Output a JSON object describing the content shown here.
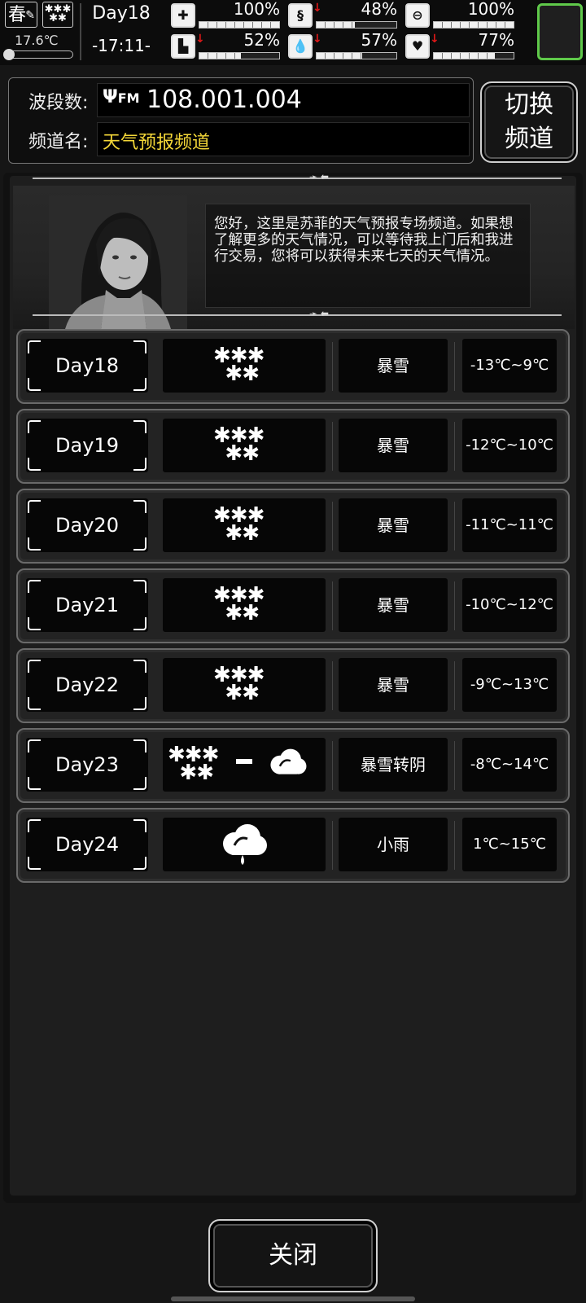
{
  "status": {
    "season": "春",
    "temperature": "17.6℃",
    "day": "Day18",
    "time": "-17:11-",
    "stats": [
      {
        "name": "health",
        "value": "100%",
        "fill": 1.0,
        "down": false,
        "icon": "medkit-icon"
      },
      {
        "name": "hunger",
        "value": "48%",
        "fill": 0.48,
        "down": true,
        "icon": "stomach-icon"
      },
      {
        "name": "medicine",
        "value": "100%",
        "fill": 1.0,
        "down": false,
        "icon": "pill-icon"
      },
      {
        "name": "stamina",
        "value": "52%",
        "fill": 0.52,
        "down": true,
        "icon": "boot-icon"
      },
      {
        "name": "thirst",
        "value": "57%",
        "fill": 0.57,
        "down": true,
        "icon": "water-drop-icon"
      },
      {
        "name": "mood",
        "value": "77%",
        "fill": 0.77,
        "down": true,
        "icon": "heart-icon"
      }
    ]
  },
  "radio": {
    "band_label": "波段数:",
    "fm": "FM",
    "frequency": "108.001.004",
    "channel_label": "频道名:",
    "channel_name": "天气预报频道",
    "switch_line1": "切换",
    "switch_line2": "频道"
  },
  "message": "您好，这里是苏菲的天气预报专场频道。如果想了解更多的天气情况，可以等待我上门后和我进行交易，您将可以获得未来七天的天气情况。",
  "forecast": [
    {
      "day": "Day18",
      "weather": "暴雪",
      "temp": "-13℃~9℃",
      "icon": "blizzard"
    },
    {
      "day": "Day19",
      "weather": "暴雪",
      "temp": "-12℃~10℃",
      "icon": "blizzard"
    },
    {
      "day": "Day20",
      "weather": "暴雪",
      "temp": "-11℃~11℃",
      "icon": "blizzard"
    },
    {
      "day": "Day21",
      "weather": "暴雪",
      "temp": "-10℃~12℃",
      "icon": "blizzard"
    },
    {
      "day": "Day22",
      "weather": "暴雪",
      "temp": "-9℃~13℃",
      "icon": "blizzard"
    },
    {
      "day": "Day23",
      "weather": "暴雪转阴",
      "temp": "-8℃~14℃",
      "icon": "blizzard-to-cloudy"
    },
    {
      "day": "Day24",
      "weather": "小雨",
      "temp": "1℃~15℃",
      "icon": "light-rain"
    }
  ],
  "close_label": "关闭"
}
